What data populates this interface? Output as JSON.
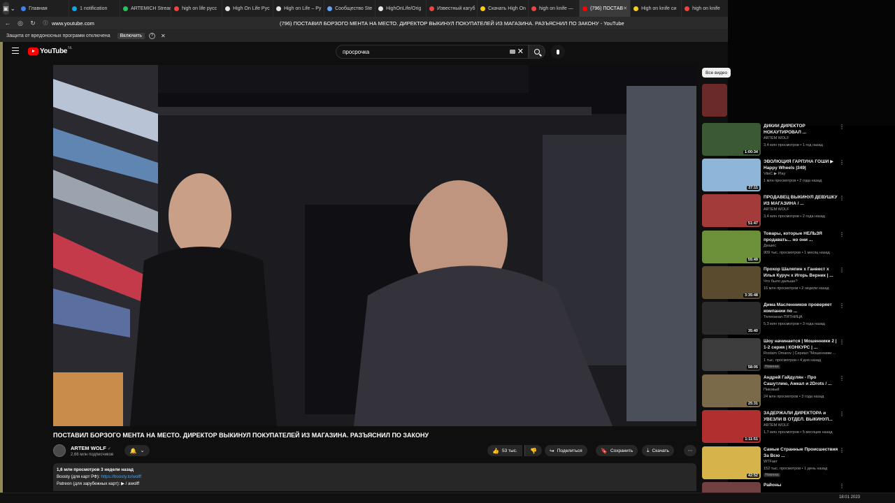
{
  "browser": {
    "tabs": [
      {
        "label": "Главная",
        "color": "#3b82f6"
      },
      {
        "label": "1 notification",
        "color": "#0ea5e9"
      },
      {
        "label": "ARTEMICH Stream",
        "color": "#22c55e"
      },
      {
        "label": "high on life русс",
        "color": "#ef4444"
      },
      {
        "label": "High On Life Pyc",
        "color": "#e5e7eb"
      },
      {
        "label": "High on Life – Py",
        "color": "#e5e7eb"
      },
      {
        "label": "Сообщество Ste",
        "color": "#60a5fa"
      },
      {
        "label": "HighOnLife/Orig",
        "color": "#e5e7eb"
      },
      {
        "label": "Известный кагуб",
        "color": "#ef4444"
      },
      {
        "label": "Скачать High On",
        "color": "#facc15"
      },
      {
        "label": "high on knife —",
        "color": "#ef4444"
      },
      {
        "label": "(796) ПОСТАВ",
        "color": "#ff0000",
        "active": true
      },
      {
        "label": "High on knife си",
        "color": "#facc15"
      },
      {
        "label": "high on knife",
        "color": "#ef4444"
      }
    ],
    "url": "www.youtube.com",
    "page_title": "(796) ПОСТАВИЛ БОРЗОГО МЕНТА НА МЕСТО. ДИРЕКТОР ВЫКИНУЛ ПОКУПАТЕЛЕЙ ИЗ МАГАЗИНА. РАЗЪЯСНИЛ ПО ЗАКОНУ - YouTube",
    "infobar_text": "Защита от вредоносных программ отключена",
    "infobar_enable": "Включить"
  },
  "youtube": {
    "logo_text": "YouTube",
    "country": "NL",
    "search_value": "просрочка"
  },
  "video": {
    "title": "ПОСТАВИЛ БОРЗОГО МЕНТА НА МЕСТО. ДИРЕКТОР ВЫКИНУЛ ПОКУПАТЕЛЕЙ ИЗ МАГАЗИНА. РАЗЪЯСНИЛ ПО ЗАКОНУ",
    "channel": "ARTEM WOLF",
    "subscribers": "2,66 млн подписчиков",
    "likes": "53 тыс.",
    "share": "Поделиться",
    "save": "Сохранить",
    "download": "Скачать",
    "desc_stats": "1,6 млн просмотров  3 недели назад",
    "desc_line1_label": "Boosty (для карт РФ): ",
    "desc_line1_link": "https://boosty.to/wolff",
    "desc_line2": "Patreon (для зарубежных карт):  ▶ / awolff"
  },
  "sidebar": {
    "chip": "Все видео",
    "items": [
      {
        "title": "ДИКИЙ ДИРЕКТОР НОКАУТИРОВАЛ ...",
        "channel": "ARTEM WOLF",
        "meta": "3,4 млн просмотров • 1 год назад",
        "duration": "1:00:34",
        "bg": "#3b5a34"
      },
      {
        "title": "ЭВОЛЮЦИЯ ГАРПУНА ГОШИ ▶ Happy Wheels |349|",
        "channel": "VitеC ▶ Play",
        "meta": "1 млн просмотров • 2 года назад",
        "duration": "27:11",
        "bg": "#8fb6d9"
      },
      {
        "title": "ПРОДАВЕЦ ВЫКИНУЛ ДЕВУШКУ ИЗ МАГАЗИНА / ...",
        "channel": "ARTEM WOLF",
        "meta": "3,4 млн просмотров • 2 года назад",
        "duration": "51:47",
        "bg": "#a33b3b"
      },
      {
        "title": "Товары, которые НЕЛЬЗЯ продавать... но они ...",
        "channel": "Дюшес",
        "meta": "909 тыс. просмотров • 1 месяц назад",
        "duration": "55:49",
        "bg": "#6c8f3a"
      },
      {
        "title": "Прохор Шаляпин х Ганвест х Илья Куруч х Игорь Верник | ...",
        "channel": "Что было дальше?",
        "meta": "16 млн просмотров • 2 недели назад",
        "duration": "3:35:48",
        "bg": "#5a4a2e"
      },
      {
        "title": "Дима Масленников проверяет компании по ...",
        "channel": "Телеканал ПЯТНИЦА",
        "meta": "5,3 млн просмотров • 3 года назад",
        "duration": "35:40",
        "bg": "#2b2b2b"
      },
      {
        "title": "Шоу начинается | Мошенники 2 | 1-2 серия | КОНКУРС | ...",
        "channel": "Rostam Omarov | Сериал \"Мошенники ...",
        "meta": "1 тыс. просмотров • 4 дня назад",
        "badge": "Новинка",
        "duration": "58:05",
        "bg": "#3c3c3c"
      },
      {
        "title": "Андрей Гайдулян - Про Сашутлию, Амкал и 2Drots / ...",
        "channel": "Пиковый",
        "meta": "24 млн просмотров • 3 года назад",
        "duration": "25:31",
        "bg": "#7a6a4a"
      },
      {
        "title": "ЗАДЕРЖАЛИ ДИРЕКТОРА и УВЕЗЛИ В ОТДЕЛ. ВЫКИНУЛ...",
        "channel": "ARTEM WOLF",
        "meta": "1,7 млн просмотров • 5 месяцев назад",
        "duration": "1:11:51",
        "bg": "#b12f2f"
      },
      {
        "title": "Самые Странные Происшествия За Всю ...",
        "channel": "WTFакт",
        "meta": "152 тыс. просмотров • 1 день назад",
        "badge": "Новинка",
        "duration": "42:52",
        "bg": "#d7b44a"
      },
      {
        "title": "Районы",
        "channel": "",
        "meta": "",
        "duration": "",
        "bg": "#704040"
      }
    ]
  },
  "taskbar": {
    "time": "18:01 2023"
  }
}
